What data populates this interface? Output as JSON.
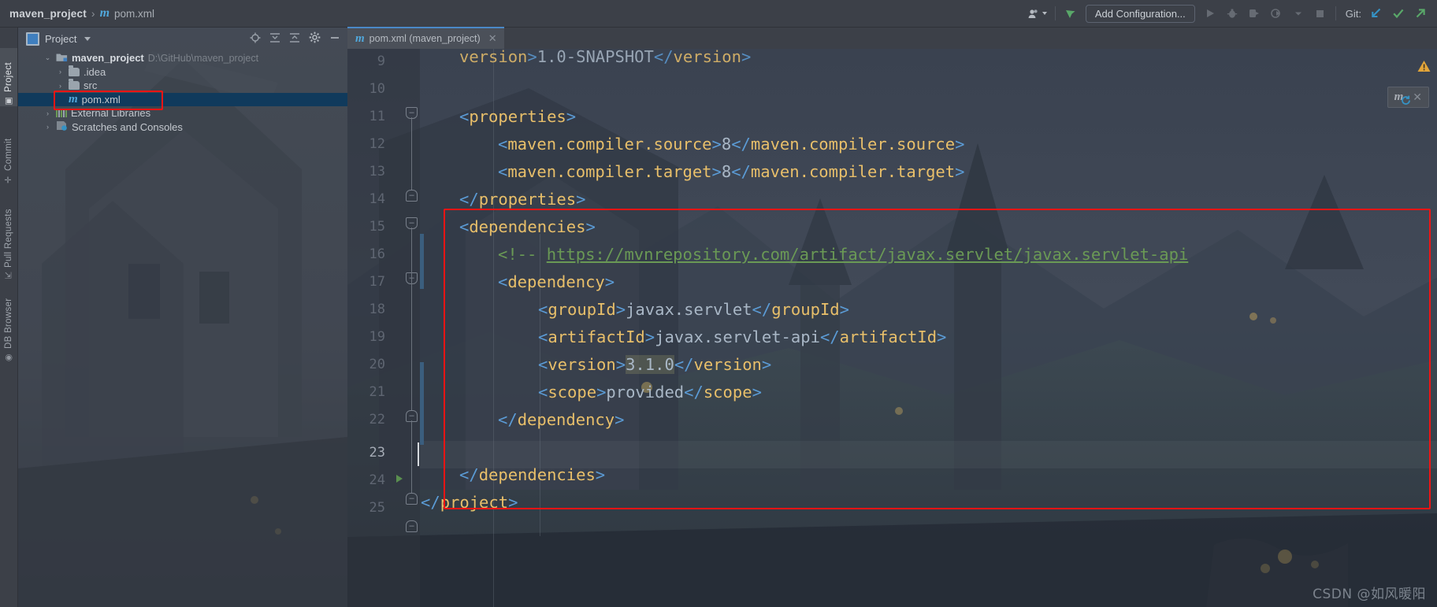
{
  "window": {
    "breadcrumb_project": "maven_project",
    "breadcrumb_separator": "›",
    "breadcrumb_file": "pom.xml",
    "maven_icon_glyph": "m"
  },
  "toolbar": {
    "user_icon": "user-icon",
    "vcs_update_icon": "vcs-update-icon",
    "add_configuration_label": "Add Configuration...",
    "run_icon": "run-icon",
    "debug_icon": "debug-icon",
    "run_coverage_icon": "run-with-coverage-icon",
    "profile_icon": "profiler-icon",
    "dropdown_icon": "chevron-down-icon",
    "stop_icon": "stop-icon",
    "git_label": "Git:",
    "git_update_icon": "git-update-project-icon",
    "git_commit_icon": "git-commit-icon",
    "git_push_icon": "git-push-icon"
  },
  "sidebar_strip": {
    "items": [
      {
        "label": "Project",
        "icon": "project-icon",
        "selected": true
      },
      {
        "label": "Commit",
        "icon": "commit-icon",
        "selected": false
      },
      {
        "label": "Pull Requests",
        "icon": "pull-requests-icon",
        "selected": false
      },
      {
        "label": "DB Browser",
        "icon": "db-browser-icon",
        "selected": false
      }
    ]
  },
  "project_panel": {
    "title": "Project",
    "title_icon": "project-window-icon",
    "dropdown_icon": "chevron-down-icon",
    "header_icons": [
      {
        "name": "locate-icon"
      },
      {
        "name": "expand-all-icon"
      },
      {
        "name": "collapse-all-icon"
      },
      {
        "name": "settings-gear-icon"
      },
      {
        "name": "hide-icon"
      }
    ],
    "tree": [
      {
        "depth": 0,
        "arrow": "⌄",
        "icon": "module-folder-icon",
        "label": "maven_project",
        "bold": true,
        "path": "D:\\GitHub\\maven_project",
        "selected": false
      },
      {
        "depth": 1,
        "arrow": "›",
        "icon": "folder-icon",
        "label": ".idea",
        "bold": false,
        "path": "",
        "selected": false
      },
      {
        "depth": 1,
        "arrow": "›",
        "icon": "folder-icon",
        "label": "src",
        "bold": false,
        "path": "",
        "selected": false
      },
      {
        "depth": 1,
        "arrow": "",
        "icon": "maven-pom-icon",
        "label": "pom.xml",
        "bold": false,
        "path": "",
        "selected": true
      },
      {
        "depth": 0,
        "arrow": "›",
        "icon": "external-libraries-icon",
        "label": "External Libraries",
        "bold": false,
        "path": "",
        "selected": false
      },
      {
        "depth": 0,
        "arrow": "›",
        "icon": "scratches-icon",
        "label": "Scratches and Consoles",
        "bold": false,
        "path": "",
        "selected": false
      }
    ]
  },
  "editor": {
    "tab_label": "pom.xml (maven_project)",
    "tab_icon": "maven-pom-icon",
    "tab_close_icon": "close-icon",
    "warning_icon": "warning-triangle-icon",
    "maven_reload_popup": {
      "icon": "maven-reload-icon",
      "close_icon": "close-icon"
    },
    "caret_line": 23,
    "lines": [
      {
        "num": 9,
        "text": "        <version>1.0-SNAPSHOT</version>",
        "partial": true
      },
      {
        "num": 10,
        "text": ""
      },
      {
        "num": 11,
        "text": "    <properties>"
      },
      {
        "num": 12,
        "text": "        <maven.compiler.source>8</maven.compiler.source>"
      },
      {
        "num": 13,
        "text": "        <maven.compiler.target>8</maven.compiler.target>"
      },
      {
        "num": 14,
        "text": "    </properties>"
      },
      {
        "num": 15,
        "text": "    <dependencies>"
      },
      {
        "num": 16,
        "text": "        <!-- https://mvnrepository.com/artifact/javax.servlet/javax.servlet-api"
      },
      {
        "num": 17,
        "text": "        <dependency>"
      },
      {
        "num": 18,
        "text": "            <groupId>javax.servlet</groupId>"
      },
      {
        "num": 19,
        "text": "            <artifactId>javax.servlet-api</artifactId>"
      },
      {
        "num": 20,
        "text": "            <version>3.1.0</version>"
      },
      {
        "num": 21,
        "text": "            <scope>provided</scope>"
      },
      {
        "num": 22,
        "text": "        </dependency>"
      },
      {
        "num": 23,
        "text": ""
      },
      {
        "num": 24,
        "text": "    </dependencies>"
      },
      {
        "num": 25,
        "text": "</project>"
      }
    ],
    "highlighted_token": "3.1.0",
    "comment_url": "https://mvnrepository.com/artifact/javax.servlet/javax.servlet-api"
  },
  "annotation": {
    "red_box_tree": "highlights pom.xml node",
    "red_box_code": "highlights dependencies block"
  },
  "watermark": "CSDN @如风暖阳",
  "colors": {
    "accent_blue": "#51a8dc",
    "tag": "#e8bf6a",
    "bracket": "#5b9bd5",
    "value": "#a9b7c6",
    "comment": "#6a9955",
    "annotation_red": "#f11414",
    "selection": "#103a5c"
  }
}
